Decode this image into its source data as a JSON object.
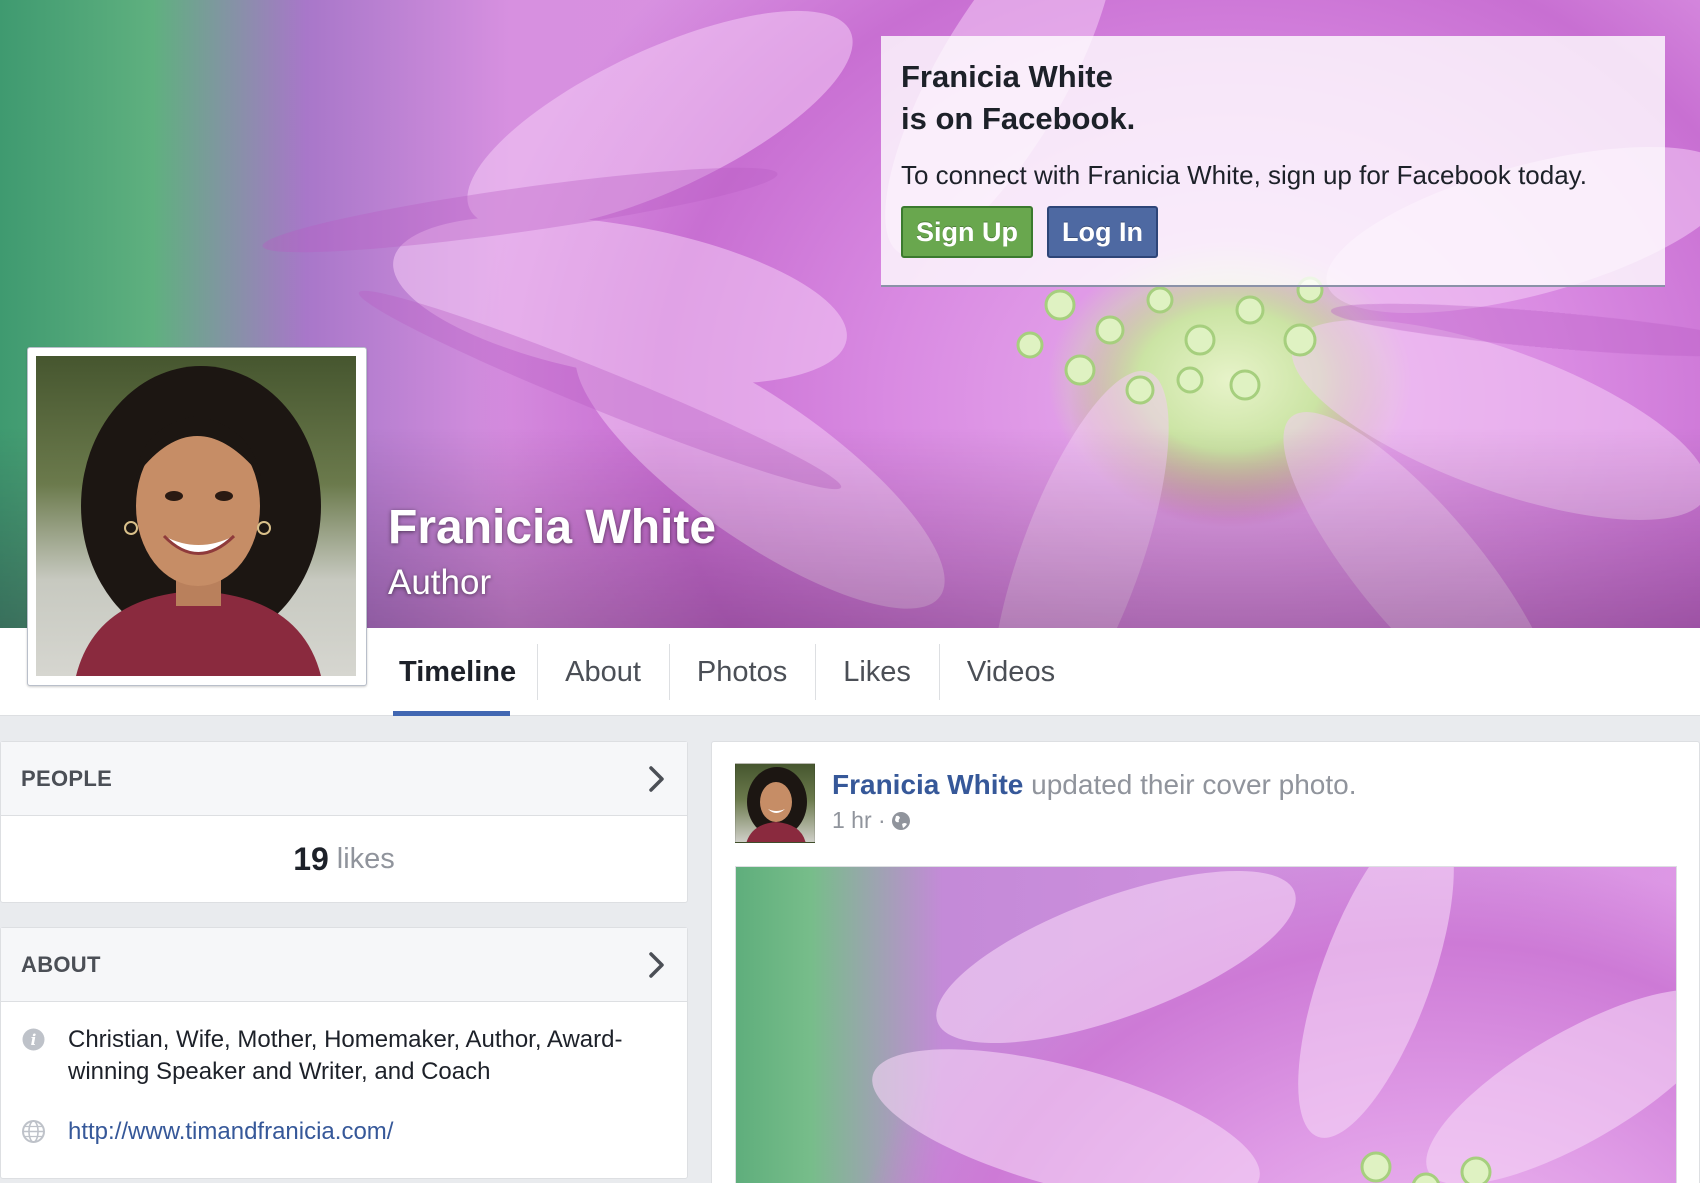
{
  "profile": {
    "name": "Franicia White",
    "category": "Author"
  },
  "signup_box": {
    "title_line1": "Franicia White",
    "title_line2": "is on Facebook.",
    "text": "To connect with Franicia White, sign up for Facebook today.",
    "signup_label": "Sign Up",
    "login_label": "Log In"
  },
  "tabs": [
    {
      "label": "Timeline",
      "active": true
    },
    {
      "label": "About",
      "active": false
    },
    {
      "label": "Photos",
      "active": false
    },
    {
      "label": "Likes",
      "active": false
    },
    {
      "label": "Videos",
      "active": false
    }
  ],
  "people_card": {
    "title": "PEOPLE",
    "likes_count": "19",
    "likes_label": "likes"
  },
  "about_card": {
    "title": "ABOUT",
    "description": "Christian, Wife, Mother, Homemaker, Author, Award-winning Speaker and Writer, and Coach",
    "website": "http://www.timandfranicia.com/",
    "description_icon": "info-icon",
    "website_icon": "globe-icon"
  },
  "post": {
    "author": "Franicia White",
    "action": "updated their cover photo.",
    "time": "1 hr ·",
    "privacy_icon": "globe-icon"
  },
  "colors": {
    "signup_green": "#69a74e",
    "login_blue": "#4e69a2",
    "link_blue": "#365899",
    "tab_active_underline": "#4267b2",
    "page_background": "#e9ebee"
  }
}
